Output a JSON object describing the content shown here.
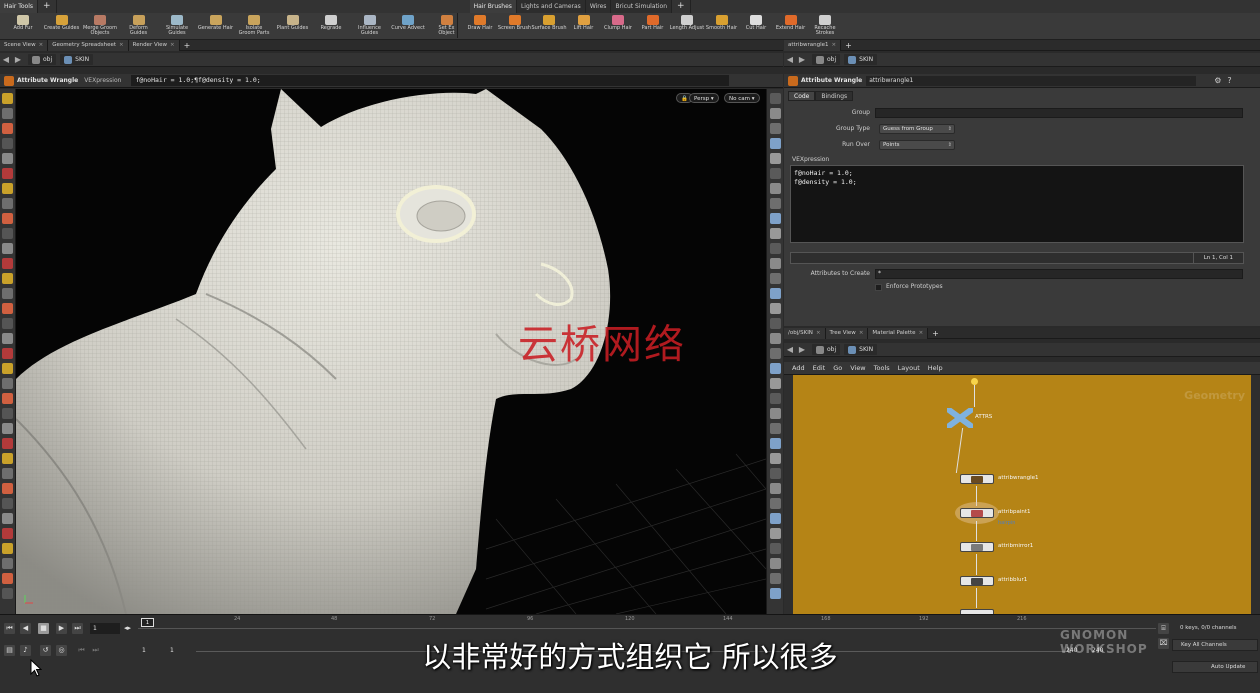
{
  "shelf": {
    "tab_groups": [
      [
        {
          "label": "Hair Tools",
          "active": true
        }
      ],
      [
        {
          "label": "Hair Brushes",
          "active": true
        },
        {
          "label": "Lights and Cameras"
        },
        {
          "label": "Wires"
        },
        {
          "label": "Bricut Simulation"
        }
      ]
    ],
    "plus": "+",
    "tools_left": [
      {
        "label": "Add Fur",
        "icon": "fur-icon",
        "color": "#cfc7a8"
      },
      {
        "label": "Create Guides",
        "icon": "guides-icon",
        "color": "#d7a23a"
      },
      {
        "label": "Merge Groom\nObjects",
        "icon": "merge-icon",
        "color": "#b87a64"
      },
      {
        "label": "Deform\nGuides",
        "icon": "deform-icon",
        "color": "#c7a05a"
      },
      {
        "label": "Simulate\nGuides",
        "icon": "simulate-icon",
        "color": "#9cb9c9"
      },
      {
        "label": "Generate Hair",
        "icon": "generate-icon",
        "color": "#c9a45c"
      },
      {
        "label": "Isolate\nGroom Parts",
        "icon": "isolate-icon",
        "color": "#c9a45c"
      },
      {
        "label": "Plant Guides",
        "icon": "plant-icon",
        "color": "#c7b38a"
      },
      {
        "label": "Regrade",
        "icon": "regrade-icon",
        "color": "#cfcfcf"
      },
      {
        "label": "Influence\nGuides",
        "icon": "influence-icon",
        "color": "#aab6c4"
      },
      {
        "label": "Curve Advect",
        "icon": "curve-icon",
        "color": "#6fa3c9"
      },
      {
        "label": "Set Ex\nObject",
        "icon": "setobj-icon",
        "color": "#d08040"
      }
    ],
    "tools_right": [
      {
        "label": "Draw Hair",
        "icon": "draw-hair-icon",
        "color": "#e07a2a"
      },
      {
        "label": "Screen Brush",
        "icon": "screen-brush-icon",
        "color": "#e07a2a"
      },
      {
        "label": "Surface Brush",
        "icon": "surface-brush-icon",
        "color": "#d9a030"
      },
      {
        "label": "Lift Hair",
        "icon": "lift-hair-icon",
        "color": "#e0a040"
      },
      {
        "label": "Clump Hair",
        "icon": "clump-hair-icon",
        "color": "#d86a8a"
      },
      {
        "label": "Part Hair",
        "icon": "part-hair-icon",
        "color": "#e06a2a"
      },
      {
        "label": "Length Adjust",
        "icon": "length-icon",
        "color": "#cfcfcf"
      },
      {
        "label": "Smooth Hair",
        "icon": "smooth-hair-icon",
        "color": "#d9a030"
      },
      {
        "label": "Cut Hair",
        "icon": "cut-hair-icon",
        "color": "#dddddd"
      },
      {
        "label": "Extend Hair",
        "icon": "extend-hair-icon",
        "color": "#e06a2a"
      },
      {
        "label": "Recache\nStrokes",
        "icon": "recache-icon",
        "color": "#cfcfcf"
      }
    ]
  },
  "viewer": {
    "tabs": [
      {
        "label": "Scene View"
      },
      {
        "label": "Geometry Spreadsheet"
      },
      {
        "label": "Render View"
      }
    ],
    "path": {
      "obj": "obj",
      "node": "SKIN"
    },
    "header": {
      "title": "Attribute Wrangle",
      "label": "VEXpression",
      "expression": "f@noHair = 1.0;¶f@density = 1.0;"
    },
    "persp": "Persp",
    "camera": "No cam",
    "watermark": "云桥网络"
  },
  "parms": {
    "tab": {
      "label": "attribwrangle1"
    },
    "path": {
      "obj": "obj",
      "node": "SKIN"
    },
    "header": {
      "title": "Attribute Wrangle",
      "node_name": "attribwrangle1"
    },
    "subtabs": [
      "Code",
      "Bindings"
    ],
    "group_label": "Group",
    "group_type_label": "Group Type",
    "group_type_value": "Guess from Group",
    "run_over_label": "Run Over",
    "run_over_value": "Points",
    "vex_label": "VEXpression",
    "vex_code": "f@noHair = 1.0;\nf@density = 1.0;",
    "cursor_pos": "Ln 1, Col 1",
    "attrs_label": "Attributes to Create",
    "attrs_value": "*",
    "enforce_label": "Enforce Prototypes"
  },
  "network": {
    "tabs": [
      {
        "label": "/obj/SKIN"
      },
      {
        "label": "Tree View"
      },
      {
        "label": "Material Palette"
      }
    ],
    "path": {
      "obj": "obj",
      "node": "SKIN"
    },
    "menu": [
      "Add",
      "Edit",
      "Go",
      "View",
      "Tools",
      "Layout",
      "Help"
    ],
    "context_label": "Geometry",
    "nodes": [
      {
        "name": "ATTRS",
        "kind": "merge"
      },
      {
        "name": "attribwrangle1",
        "kind": "wrangle"
      },
      {
        "name": "attribpaint1",
        "kind": "paint",
        "sub": "hairpin"
      },
      {
        "name": "attribmirror1",
        "kind": "mirror"
      },
      {
        "name": "attribblur1",
        "kind": "blur"
      }
    ]
  },
  "timeline": {
    "frame": "1",
    "current": "1",
    "ticks": [
      "24",
      "48",
      "72",
      "96",
      "120",
      "144",
      "168",
      "192",
      "216"
    ],
    "range_start": "1",
    "range_start2": "1",
    "range_end": "240",
    "range_end2": "240",
    "keys_info": "0 keys, 0/0 channels",
    "key_all": "Key All Channels",
    "auto_update": "Auto Update"
  },
  "subtitle": "以非常好的方式组织它 所以很多",
  "corner_logo": "GNOMON\nWORKSHOP"
}
